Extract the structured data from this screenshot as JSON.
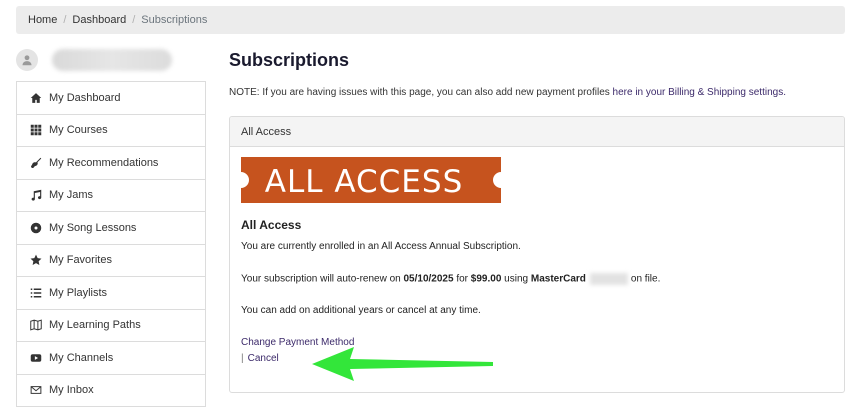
{
  "breadcrumb": [
    "Home",
    "Dashboard",
    "Subscriptions"
  ],
  "sidebar": {
    "items": [
      {
        "label": "My Dashboard",
        "icon": "home-icon"
      },
      {
        "label": "My Courses",
        "icon": "grid-icon"
      },
      {
        "label": "My Recommendations",
        "icon": "guitar-icon"
      },
      {
        "label": "My Jams",
        "icon": "music-note-icon"
      },
      {
        "label": "My Song Lessons",
        "icon": "record-icon"
      },
      {
        "label": "My Favorites",
        "icon": "star-icon"
      },
      {
        "label": "My Playlists",
        "icon": "list-icon"
      },
      {
        "label": "My Learning Paths",
        "icon": "map-icon"
      },
      {
        "label": "My Channels",
        "icon": "youtube-icon"
      },
      {
        "label": "My Inbox",
        "icon": "envelope-icon"
      }
    ]
  },
  "main": {
    "title": "Subscriptions",
    "note_prefix": "NOTE: If you are having issues with this page, you can also add new payment profiles ",
    "note_link": "here in your Billing & Shipping settings.",
    "card": {
      "header": "All Access",
      "logo_text": "ALL ACCESS",
      "heading": "All Access",
      "enrolled": "You are currently enrolled in an All Access Annual Subscription.",
      "renew_prefix": "Your subscription will auto-renew on ",
      "renew_date": "05/10/2025",
      "renew_mid": " for ",
      "renew_price": "$99.00",
      "renew_using": " using ",
      "renew_card": "MasterCard",
      "renew_suffix": "on file.",
      "add_years": "You can add on additional years or cancel at any time.",
      "change_payment": "Change Payment Method",
      "separator": "|",
      "cancel": "Cancel"
    }
  },
  "colors": {
    "logo_orange": "#c6531e",
    "link_purple": "#3c2a6a",
    "arrow_green": "#33e63a"
  }
}
